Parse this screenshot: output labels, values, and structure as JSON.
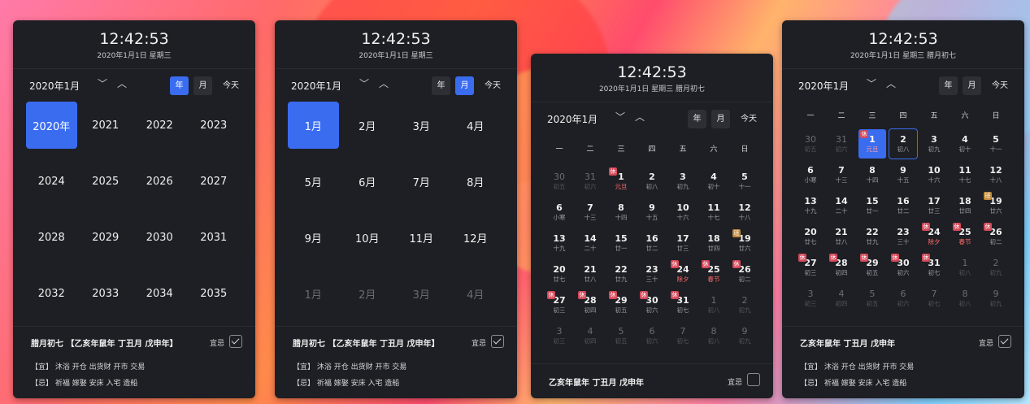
{
  "time": "12:42:53",
  "date_short": "2020年1月1日 星期三",
  "date_lunar": "2020年1月1日 星期三 腊月初七",
  "month_title": "2020年1月",
  "buttons": {
    "year": "年",
    "month": "月",
    "today": "今天"
  },
  "years": [
    "2020年",
    "2021",
    "2022",
    "2023",
    "2024",
    "2025",
    "2026",
    "2027",
    "2028",
    "2029",
    "2030",
    "2031",
    "2032",
    "2033",
    "2034",
    "2035"
  ],
  "months": [
    "1月",
    "2月",
    "3月",
    "4月",
    "5月",
    "6月",
    "7月",
    "8月",
    "9月",
    "10月",
    "11月",
    "12月",
    "1月",
    "2月",
    "3月",
    "4月"
  ],
  "weekdays": [
    "一",
    "二",
    "三",
    "四",
    "五",
    "六",
    "日"
  ],
  "footer": {
    "title_long": "腊月初七 【乙亥年鼠年 丁丑月 戊申年】",
    "title_short": "乙亥年鼠年  丁丑月  戊申年",
    "yiji_label": "宜忌",
    "yi": "【宜】  沐浴  开仓  出货财  开市  交易",
    "ji": "【忌】  祈福  嫁娶  安床  入宅  造船"
  },
  "days": [
    {
      "n": "30",
      "l": "初五",
      "out": true
    },
    {
      "n": "31",
      "l": "初六",
      "out": true
    },
    {
      "n": "1",
      "l": "元旦",
      "badge": "休",
      "red": true
    },
    {
      "n": "2",
      "l": "初八"
    },
    {
      "n": "3",
      "l": "初九"
    },
    {
      "n": "4",
      "l": "初十"
    },
    {
      "n": "5",
      "l": "十一"
    },
    {
      "n": "6",
      "l": "小寒"
    },
    {
      "n": "7",
      "l": "十三"
    },
    {
      "n": "8",
      "l": "十四"
    },
    {
      "n": "9",
      "l": "十五"
    },
    {
      "n": "10",
      "l": "十六"
    },
    {
      "n": "11",
      "l": "十七"
    },
    {
      "n": "12",
      "l": "十八"
    },
    {
      "n": "13",
      "l": "十九"
    },
    {
      "n": "14",
      "l": "二十"
    },
    {
      "n": "15",
      "l": "廿一"
    },
    {
      "n": "16",
      "l": "廿二"
    },
    {
      "n": "17",
      "l": "廿三"
    },
    {
      "n": "18",
      "l": "廿四"
    },
    {
      "n": "19",
      "l": "廿六",
      "badge": "班"
    },
    {
      "n": "20",
      "l": "廿七"
    },
    {
      "n": "21",
      "l": "廿八"
    },
    {
      "n": "22",
      "l": "廿九"
    },
    {
      "n": "23",
      "l": "三十"
    },
    {
      "n": "24",
      "l": "除夕",
      "badge": "休",
      "red": true
    },
    {
      "n": "25",
      "l": "春节",
      "badge": "休",
      "red": true
    },
    {
      "n": "26",
      "l": "初二",
      "badge": "休"
    },
    {
      "n": "27",
      "l": "初三",
      "badge": "休"
    },
    {
      "n": "28",
      "l": "初四",
      "badge": "休"
    },
    {
      "n": "29",
      "l": "初五",
      "badge": "休"
    },
    {
      "n": "30",
      "l": "初六",
      "badge": "休"
    },
    {
      "n": "31",
      "l": "初七",
      "badge": "休"
    },
    {
      "n": "1",
      "l": "初八",
      "out": true
    },
    {
      "n": "2",
      "l": "初九",
      "out": true
    },
    {
      "n": "3",
      "l": "初三",
      "out": true
    },
    {
      "n": "4",
      "l": "初四",
      "out": true
    },
    {
      "n": "5",
      "l": "初五",
      "out": true
    },
    {
      "n": "6",
      "l": "初六",
      "out": true
    },
    {
      "n": "7",
      "l": "初七",
      "out": true
    },
    {
      "n": "8",
      "l": "初八",
      "out": true
    },
    {
      "n": "9",
      "l": "初九",
      "out": true
    }
  ]
}
